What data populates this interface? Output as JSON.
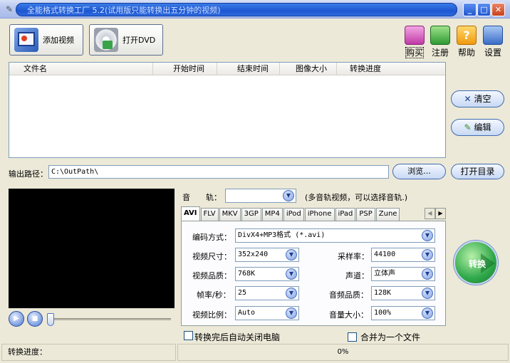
{
  "window": {
    "title": "全能格式转换工厂 5.2(试用版只能转换出五分钟的视频)",
    "app_icon": "feather-icon",
    "minimize": "_",
    "maximize": "□",
    "close": "✕"
  },
  "toolbar": {
    "add_video": "添加视频",
    "open_dvd": "打开DVD",
    "buy": "购买",
    "register": "注册",
    "help": "帮助",
    "settings": "设置"
  },
  "file_list": {
    "columns": [
      "文件名",
      "开始时间",
      "结束时间",
      "图像大小",
      "转换进度"
    ],
    "rows": []
  },
  "side_buttons": {
    "clear": "清空",
    "edit": "编辑",
    "open_dir": "打开目录",
    "convert": "转换"
  },
  "output": {
    "label": "输出路径：",
    "path": "C:\\OutPath\\",
    "browse": "浏览..."
  },
  "audio_track": {
    "label": "音　　轨：",
    "value": "",
    "hint": "(多音轨视频，可以选择音轨.)"
  },
  "format_tabs": [
    "AVI",
    "FLV",
    "MKV",
    "3GP",
    "MP4",
    "iPod",
    "iPhone",
    "iPad",
    "PSP",
    "Zune"
  ],
  "settings": {
    "codec": {
      "label": "编码方式：",
      "value": "DivX4+MP3格式 (*.avi)"
    },
    "video_size": {
      "label": "视频尺寸：",
      "value": "352x240"
    },
    "video_quality": {
      "label": "视频品质：",
      "value": "768K"
    },
    "frame_rate": {
      "label": "帧率/秒：",
      "value": "25"
    },
    "aspect_ratio": {
      "label": "视频比例：",
      "value": "Auto"
    },
    "sample_rate": {
      "label": "采样率：",
      "value": "44100"
    },
    "channels": {
      "label": "声道：",
      "value": "立体声"
    },
    "audio_quality": {
      "label": "音频品质：",
      "value": "128K"
    },
    "volume": {
      "label": "音量大小：",
      "value": "100%"
    }
  },
  "options": {
    "auto_shutdown": "转换完后自动关闭电脑",
    "merge": "合并为一个文件"
  },
  "status": {
    "label": "转换进度：",
    "progress_text": "0%",
    "progress": 0
  },
  "colors": {
    "title_bar": "#1d57d0",
    "convert_button": "#2fa84a",
    "accent_button": "#3f6bb0"
  }
}
